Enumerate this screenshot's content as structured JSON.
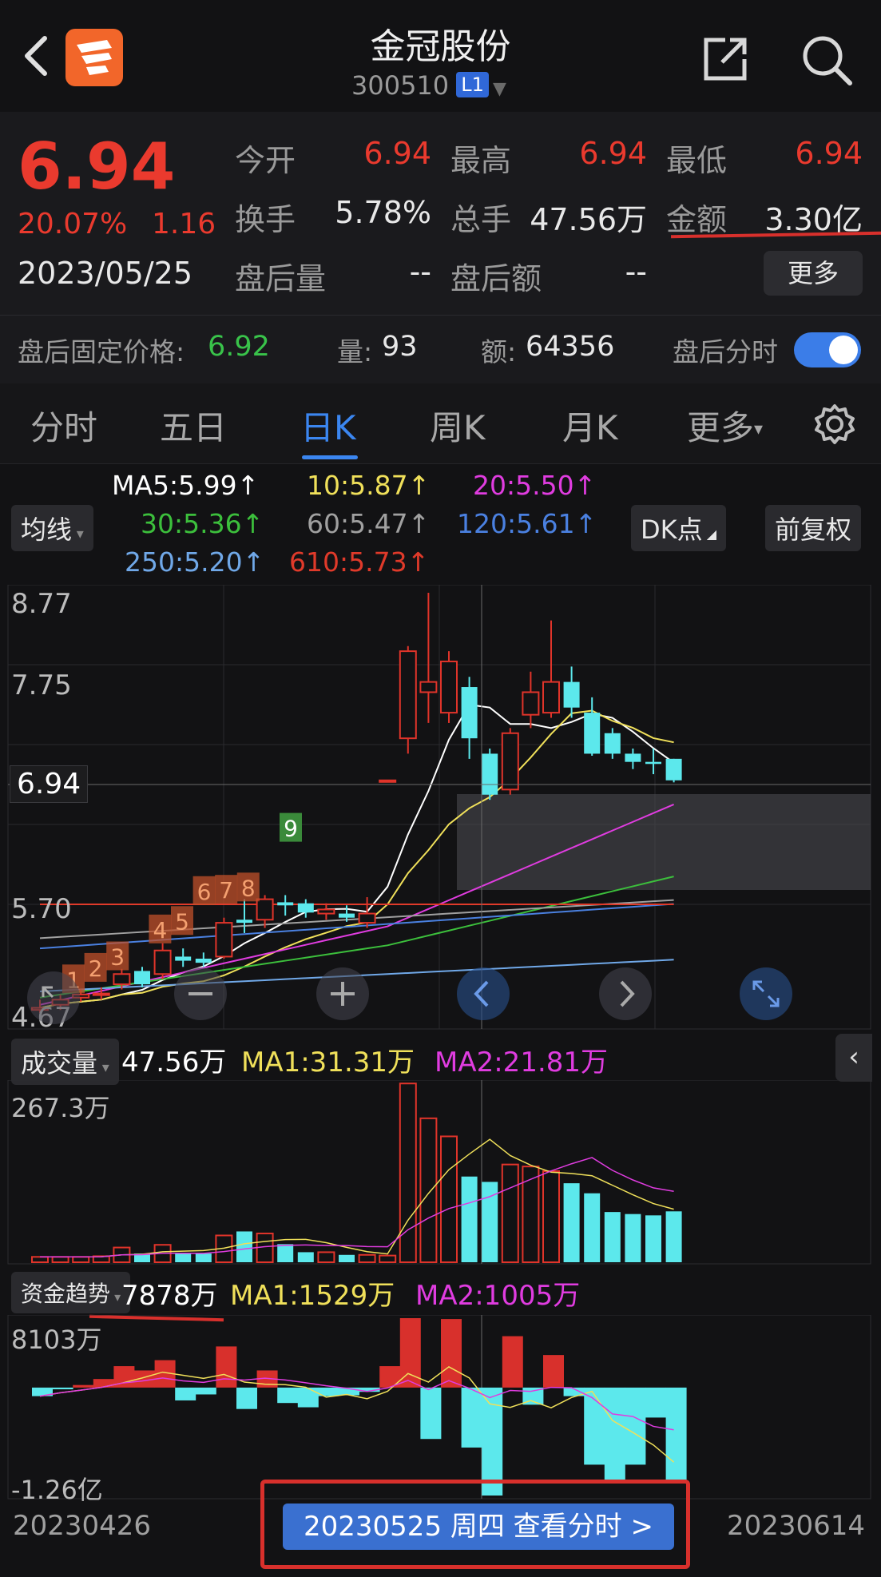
{
  "header": {
    "title": "金冠股份",
    "code": "300510",
    "level_badge": "L1"
  },
  "quote": {
    "price": "6.94",
    "change_pct": "20.07%",
    "change": "1.16",
    "date": "2023/05/25",
    "open_label": "今开",
    "open": "6.94",
    "high_label": "最高",
    "high": "6.94",
    "low_label": "最低",
    "low": "6.94",
    "turnover_label": "换手",
    "turnover": "5.78%",
    "volume_label": "总手",
    "volume": "47.56万",
    "amount_label": "金额",
    "amount": "3.30亿",
    "after_vol_label": "盘后量",
    "after_vol": "--",
    "after_amt_label": "盘后额",
    "after_amt": "--",
    "more_button": "更多"
  },
  "after_hours": {
    "price_label": "盘后固定价格:",
    "price": "6.92",
    "vol_label": "量:",
    "vol": "93",
    "amt_label": "额:",
    "amt": "64356",
    "toggle_label": "盘后分时",
    "toggle_on": true
  },
  "tabs": [
    "分时",
    "五日",
    "日K",
    "周K",
    "月K",
    "更多"
  ],
  "active_tab": "日K",
  "ma_panel": {
    "select_label": "均线",
    "ma5": "MA5:5.99↑",
    "ma10": "10:5.87↑",
    "ma20": "20:5.50↑",
    "ma30": "30:5.36↑",
    "ma60": "60:5.47↑",
    "ma120": "120:5.61↑",
    "ma250": "250:5.20↑",
    "ma610": "610:5.73↑",
    "dk_button": "DK点",
    "fq_button": "前复权",
    "colors": {
      "ma5": "#ffffff",
      "ma10": "#f0e05a",
      "ma20": "#e03ce0",
      "ma30": "#3cbf3c",
      "ma60": "#a0a0a0",
      "ma120": "#4a80e0",
      "ma250": "#70a8e8",
      "ma610": "#e03a2a"
    }
  },
  "price_axis": {
    "high": "8.77",
    "mid": "7.75",
    "current": "6.94",
    "low_mid": "5.70",
    "low": "4.67"
  },
  "countdown_labels": [
    "1",
    "2",
    "3",
    "4",
    "5",
    "6",
    "7",
    "8",
    "9"
  ],
  "volume_panel": {
    "select_label": "成交量",
    "value": "47.56万",
    "ma1": "MA1:31.31万",
    "ma2": "MA2:21.81万",
    "max_label": "267.3万"
  },
  "fund_panel": {
    "select_label": "资金趋势",
    "value": "7878万",
    "ma1": "MA1:1529万",
    "ma2": "MA2:1005万",
    "max_label": "8103万",
    "min_label": "-1.26亿"
  },
  "x_axis": {
    "start": "20230426",
    "end": "20230614",
    "selected": "20230525 周四 查看分时 >"
  },
  "chart_data": {
    "type": "candlestick",
    "ylim": [
      4.67,
      8.77
    ],
    "candles": [
      {
        "o": 4.7,
        "c": 4.72,
        "h": 4.8,
        "l": 4.67,
        "up": true
      },
      {
        "o": 4.75,
        "c": 4.8,
        "h": 4.85,
        "l": 4.7,
        "up": true
      },
      {
        "o": 4.85,
        "c": 4.82,
        "h": 4.9,
        "l": 4.78,
        "up": true
      },
      {
        "o": 4.85,
        "c": 4.86,
        "h": 4.92,
        "l": 4.8,
        "up": true
      },
      {
        "o": 4.95,
        "c": 5.05,
        "h": 5.1,
        "l": 4.9,
        "up": true
      },
      {
        "o": 5.08,
        "c": 4.95,
        "h": 5.12,
        "l": 4.92,
        "up": false
      },
      {
        "o": 5.05,
        "c": 5.28,
        "h": 5.35,
        "l": 5.0,
        "up": true
      },
      {
        "o": 5.22,
        "c": 5.18,
        "h": 5.3,
        "l": 5.12,
        "up": false
      },
      {
        "o": 5.2,
        "c": 5.16,
        "h": 5.26,
        "l": 5.12,
        "up": false
      },
      {
        "o": 5.22,
        "c": 5.55,
        "h": 5.6,
        "l": 5.2,
        "up": true
      },
      {
        "o": 5.55,
        "c": 5.58,
        "h": 5.78,
        "l": 5.45,
        "up": false
      },
      {
        "o": 5.58,
        "c": 5.78,
        "h": 5.82,
        "l": 5.5,
        "up": true
      },
      {
        "o": 5.75,
        "c": 5.72,
        "h": 5.82,
        "l": 5.62,
        "up": false
      },
      {
        "o": 5.74,
        "c": 5.65,
        "h": 5.78,
        "l": 5.6,
        "up": false
      },
      {
        "o": 5.64,
        "c": 5.68,
        "h": 5.74,
        "l": 5.58,
        "up": true
      },
      {
        "o": 5.64,
        "c": 5.6,
        "h": 5.72,
        "l": 5.56,
        "up": false
      },
      {
        "o": 5.55,
        "c": 5.64,
        "h": 5.8,
        "l": 5.5,
        "up": true
      },
      {
        "o": 6.94,
        "c": 6.94,
        "h": 6.94,
        "l": 6.94,
        "up": true
      },
      {
        "o": 7.35,
        "c": 8.2,
        "h": 8.25,
        "l": 7.2,
        "up": true
      },
      {
        "o": 7.9,
        "c": 7.8,
        "h": 8.77,
        "l": 7.5,
        "up": true
      },
      {
        "o": 7.6,
        "c": 8.1,
        "h": 8.2,
        "l": 7.5,
        "up": true
      },
      {
        "o": 7.85,
        "c": 7.35,
        "h": 7.95,
        "l": 7.15,
        "up": false
      },
      {
        "o": 7.2,
        "c": 6.8,
        "h": 7.25,
        "l": 6.75,
        "up": false
      },
      {
        "o": 6.85,
        "c": 7.4,
        "h": 7.45,
        "l": 6.8,
        "up": true
      },
      {
        "o": 7.58,
        "c": 7.8,
        "h": 8.0,
        "l": 7.45,
        "up": true
      },
      {
        "o": 7.6,
        "c": 7.9,
        "h": 8.5,
        "l": 7.55,
        "up": true
      },
      {
        "o": 7.9,
        "c": 7.65,
        "h": 8.05,
        "l": 7.55,
        "up": false
      },
      {
        "o": 7.6,
        "c": 7.2,
        "h": 7.75,
        "l": 7.18,
        "up": false
      },
      {
        "o": 7.4,
        "c": 7.2,
        "h": 7.45,
        "l": 7.15,
        "up": false
      },
      {
        "o": 7.2,
        "c": 7.12,
        "h": 7.25,
        "l": 7.05,
        "up": false
      },
      {
        "o": 7.12,
        "c": 7.1,
        "h": 7.25,
        "l": 7.0,
        "up": false
      },
      {
        "o": 7.15,
        "c": 6.94,
        "h": 7.15,
        "l": 6.92,
        "up": false
      }
    ],
    "volume": [
      8,
      8,
      8,
      9,
      22,
      13,
      26,
      13,
      13,
      40,
      46,
      43,
      27,
      15,
      15,
      11,
      11,
      10,
      267,
      215,
      188,
      128,
      120,
      146,
      143,
      136,
      118,
      103,
      75,
      72,
      70,
      76
    ],
    "volume_ylim": [
      0,
      267.3
    ],
    "fund_flow": [
      -1000,
      -200,
      300,
      1000,
      2500,
      2000,
      3200,
      -1500,
      -800,
      4800,
      -2500,
      2000,
      -1800,
      -2300,
      -1000,
      -900,
      -500,
      2500,
      8103,
      -6000,
      8000,
      -7000,
      -12600,
      6000,
      -2000,
      3800,
      -1000,
      -9000,
      -11000,
      -9000,
      -3500,
      -11000
    ],
    "fund_ylim": [
      -12600,
      8103
    ]
  }
}
